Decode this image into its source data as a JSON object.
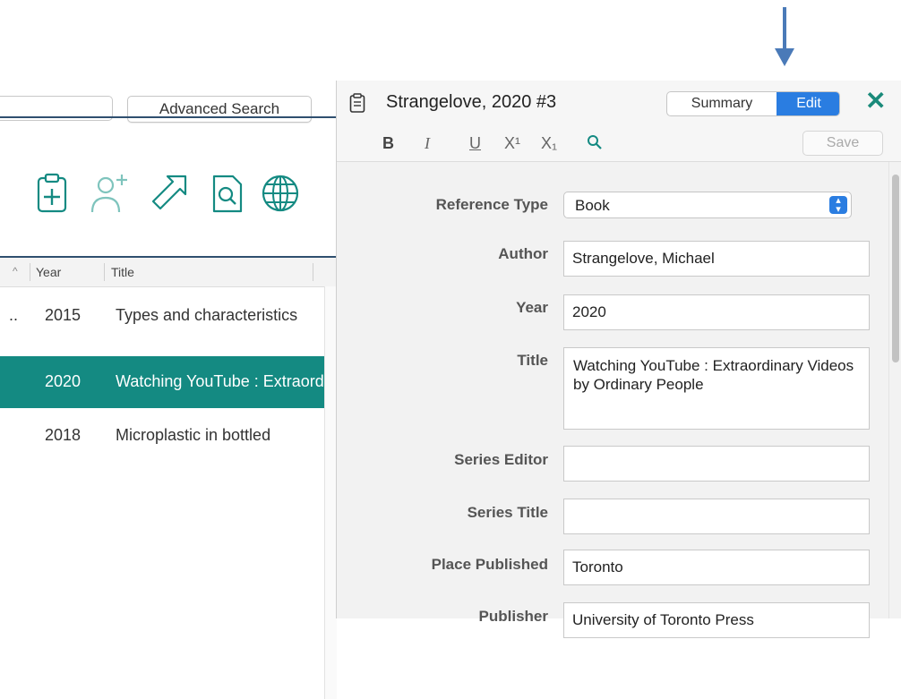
{
  "library": {
    "advanced_search_label": "Advanced Search",
    "toolbar_icons": [
      "new-reference-icon",
      "share-user-icon",
      "export-arrow-icon",
      "find-pdf-icon",
      "online-search-icon"
    ],
    "columns": {
      "year": "Year",
      "title": "Title"
    },
    "rows": [
      {
        "prefix": "..",
        "year": "2015",
        "title": "Types and characteristics",
        "selected": false
      },
      {
        "prefix": "",
        "year": "2020",
        "title": "Watching YouTube : Extraordinary",
        "selected": true
      },
      {
        "prefix": "",
        "year": "2018",
        "title": "Microplastic in bottled",
        "selected": false
      }
    ]
  },
  "editor": {
    "title": "Strangelove, 2020 #3",
    "tabs": {
      "summary": "Summary",
      "edit": "Edit"
    },
    "format_bar": {
      "bold": "B",
      "italic": "I",
      "underline": "U",
      "superscript": "X¹",
      "subscript": "X₁",
      "save": "Save"
    },
    "fields": {
      "reference_type": {
        "label": "Reference Type",
        "value": "Book"
      },
      "author": {
        "label": "Author",
        "value": "Strangelove, Michael"
      },
      "year": {
        "label": "Year",
        "value": "2020"
      },
      "title": {
        "label": "Title",
        "value": "Watching YouTube : Extraordinary Videos by Ordinary People"
      },
      "series_editor": {
        "label": "Series Editor",
        "value": ""
      },
      "series_title": {
        "label": "Series Title",
        "value": ""
      },
      "place_published": {
        "label": "Place Published",
        "value": "Toronto"
      },
      "publisher": {
        "label": "Publisher",
        "value": "University of Toronto Press"
      }
    }
  },
  "colors": {
    "accent_teal": "#148a82",
    "selected_blue": "#2a7de1",
    "annotation_arrow": "#4a7ab8"
  }
}
